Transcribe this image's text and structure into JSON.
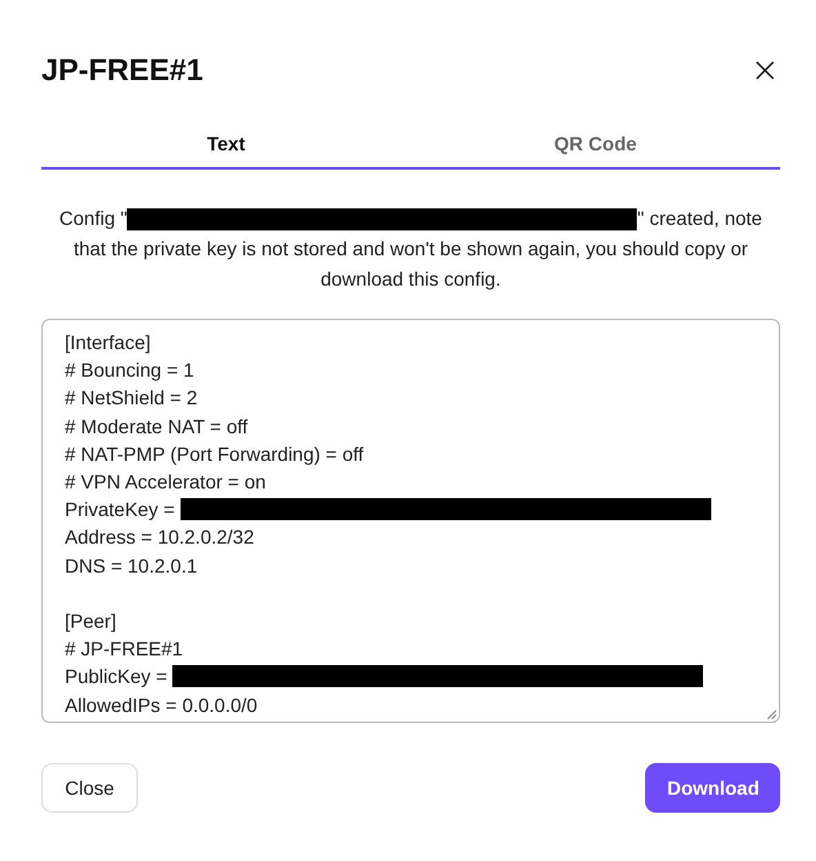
{
  "dialog": {
    "title": "JP-FREE#1"
  },
  "tabs": [
    {
      "label": "Text",
      "selected": true
    },
    {
      "label": "QR Code",
      "selected": false
    }
  ],
  "message": {
    "before": "Config \"",
    "redacted": true,
    "after": "\" created, note that the private key is not stored and won't be shown again, you should copy or download this config."
  },
  "config_lines": [
    {
      "kind": "text",
      "text": "[Interface]"
    },
    {
      "kind": "text",
      "text": "# Bouncing = 1"
    },
    {
      "kind": "text",
      "text": "# NetShield = 2"
    },
    {
      "kind": "text",
      "text": "# Moderate NAT = off"
    },
    {
      "kind": "text",
      "text": "# NAT-PMP (Port Forwarding) = off"
    },
    {
      "kind": "text",
      "text": "# VPN Accelerator = on"
    },
    {
      "kind": "redacted",
      "text": "PrivateKey ="
    },
    {
      "kind": "text",
      "text": "Address = 10.2.0.2/32"
    },
    {
      "kind": "text",
      "text": "DNS = 10.2.0.1"
    },
    {
      "kind": "blank"
    },
    {
      "kind": "text",
      "text": "[Peer]"
    },
    {
      "kind": "text",
      "text": "# JP-FREE#1"
    },
    {
      "kind": "redacted",
      "text": "PublicKey ="
    },
    {
      "kind": "text",
      "text": "AllowedIPs = 0.0.0.0/0"
    }
  ],
  "buttons": [
    {
      "label": "Close",
      "kind": "secondary"
    },
    {
      "label": "Download",
      "kind": "primary"
    }
  ]
}
